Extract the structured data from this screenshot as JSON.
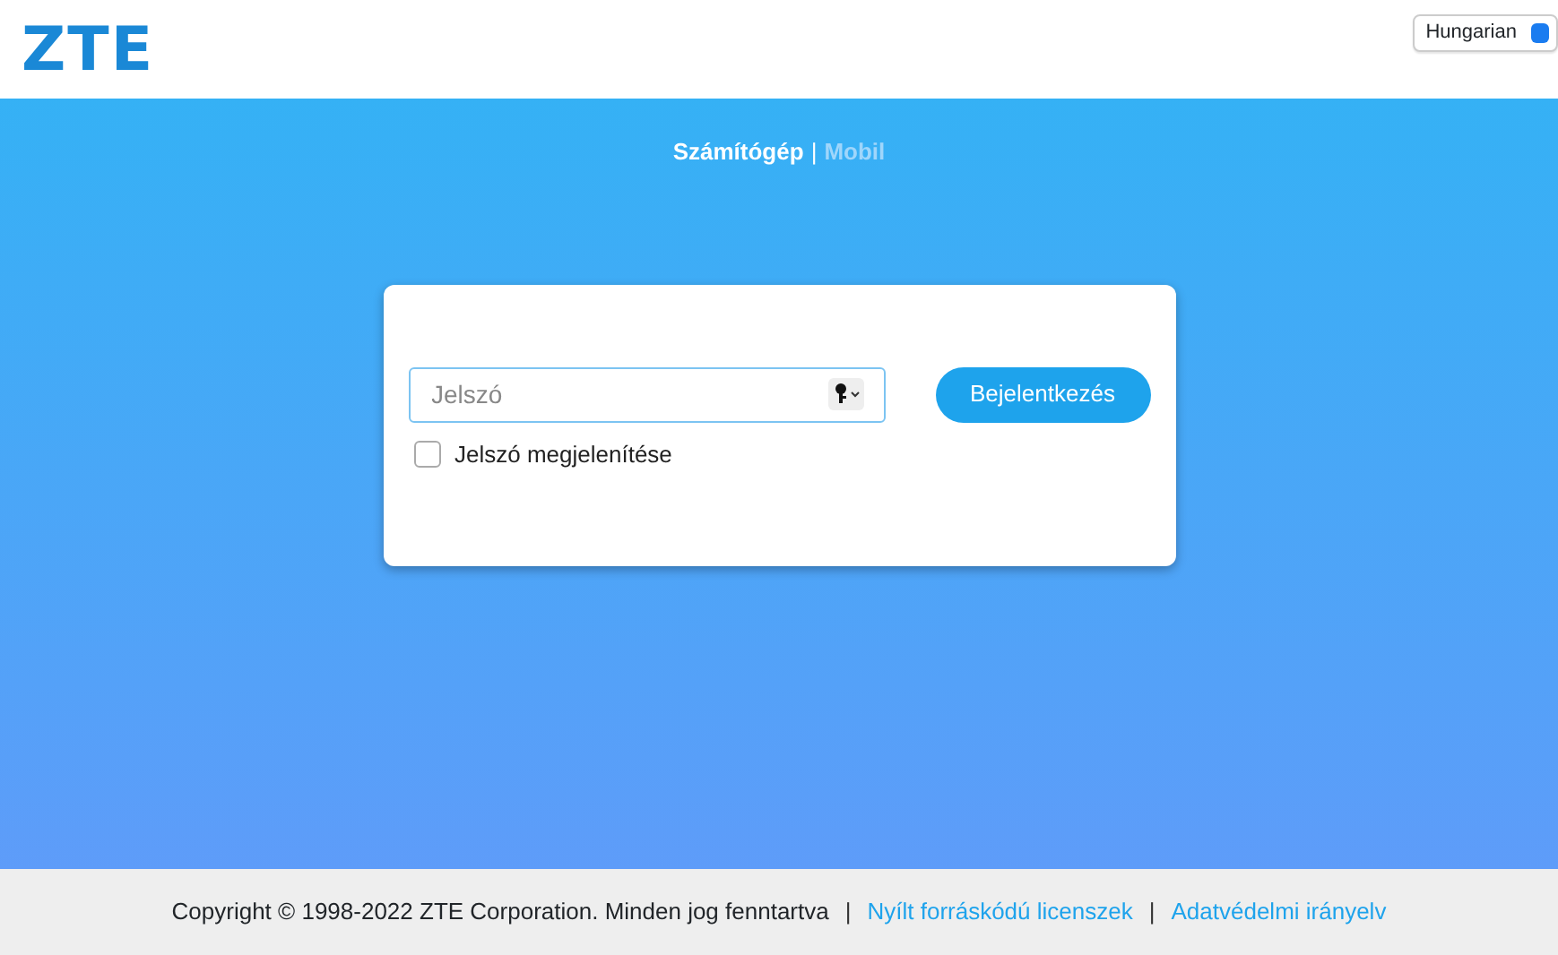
{
  "header": {
    "logo": "ZTE",
    "language": "Hungarian"
  },
  "view_tabs": {
    "separator": "|",
    "items": [
      {
        "label": "Számítógép",
        "selected": true
      },
      {
        "label": "Mobil",
        "selected": false
      }
    ]
  },
  "login": {
    "password": {
      "placeholder": "Jelszó"
    },
    "button": "Bejelentkezés",
    "show_password": {
      "label": "Jelszó megjelenítése",
      "checked": false
    }
  },
  "footer": {
    "copyright": "Copyright © 1998-2022 ZTE Corporation. Minden jog fenntartva",
    "separator": "|",
    "links": [
      "Nyílt forráskódú licenszek",
      "Adatvédelmi irányelv"
    ]
  }
}
